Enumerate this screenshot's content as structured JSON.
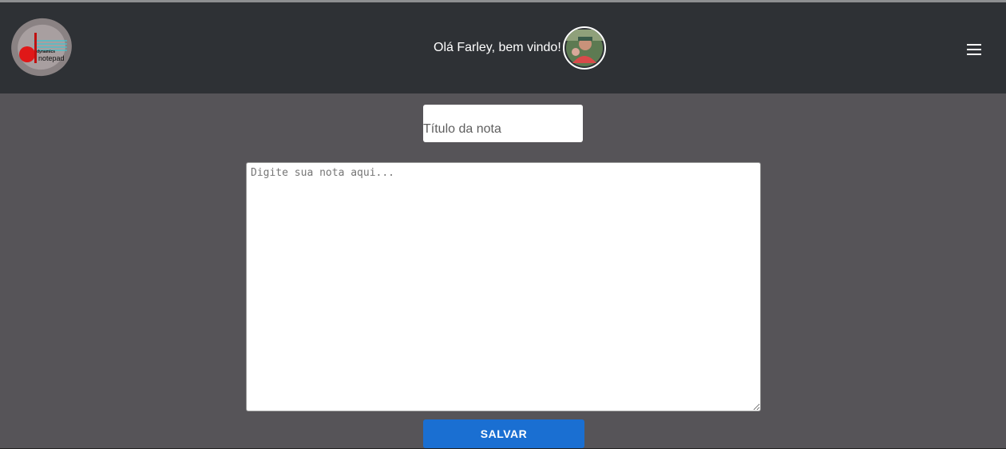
{
  "header": {
    "logo": {
      "line1": "dynamics",
      "line2": "notepad"
    },
    "greeting": "Olá Farley, bem vindo!",
    "avatar_icon": "user-avatar-photo",
    "menu_icon": "hamburger-menu-icon"
  },
  "form": {
    "title_placeholder": "Título da nota",
    "title_value": "",
    "note_placeholder": "Digite sua nota aqui...",
    "note_value": "",
    "save_label": "SALVAR"
  },
  "colors": {
    "header_bg": "#2e3135",
    "page_bg": "#565458",
    "button_bg": "#1a6fd2"
  }
}
